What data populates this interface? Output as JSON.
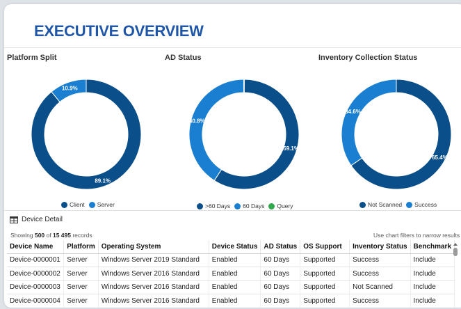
{
  "header": {
    "title": "EXECUTIVE OVERVIEW"
  },
  "colors": {
    "dark": "#0b4f8a",
    "mid": "#1a7fd1",
    "green": "#2da84a",
    "title": "#1f56a8"
  },
  "chart_data": [
    {
      "type": "pie",
      "title": "Platform Split",
      "series": [
        {
          "name": "Client",
          "value": 89.1,
          "label": "89.1%",
          "color": "#0b4f8a"
        },
        {
          "name": "Server",
          "value": 10.9,
          "label": "10.9%",
          "color": "#1a7fd1"
        }
      ],
      "legend": "bottom"
    },
    {
      "type": "pie",
      "title": "AD Status",
      "series": [
        {
          "name": ">60 Days",
          "value": 59.1,
          "label": "59.1%",
          "color": "#0b4f8a"
        },
        {
          "name": "60 Days",
          "value": 40.8,
          "label": "40.8%",
          "color": "#1a7fd1"
        },
        {
          "name": "Query",
          "value": 0.1,
          "label": "",
          "color": "#2da84a"
        }
      ],
      "legend": "bottom"
    },
    {
      "type": "pie",
      "title": "Inventory Collection Status",
      "series": [
        {
          "name": "Not Scanned",
          "value": 65.4,
          "label": "65.4%",
          "color": "#0b4f8a"
        },
        {
          "name": "Success",
          "value": 34.6,
          "label": "34.6%",
          "color": "#1a7fd1"
        }
      ],
      "legend": "bottom"
    }
  ],
  "detail": {
    "title": "Device Detail",
    "showing_prefix": "Showing ",
    "shown_count": "500",
    "of_text": " of ",
    "total_count": "15 495",
    "records_suffix": " records",
    "hint": "Use chart filters to narrow results",
    "columns": [
      "Device Name",
      "Platform",
      "Operating System",
      "Device Status",
      "AD Status",
      "OS Support",
      "Inventory Status",
      "Benchmark"
    ],
    "rows": [
      [
        "Device-0000001",
        "Server",
        "Windows Server 2019 Standard",
        "Enabled",
        "60 Days",
        "Supported",
        "Success",
        "Include"
      ],
      [
        "Device-0000002",
        "Server",
        "Windows Server 2016 Standard",
        "Enabled",
        "60 Days",
        "Supported",
        "Success",
        "Include"
      ],
      [
        "Device-0000003",
        "Server",
        "Windows Server 2016 Standard",
        "Enabled",
        "60 Days",
        "Supported",
        "Not Scanned",
        "Include"
      ],
      [
        "Device-0000004",
        "Server",
        "Windows Server 2016 Standard",
        "Enabled",
        "60 Days",
        "Supported",
        "Success",
        "Include"
      ]
    ]
  }
}
